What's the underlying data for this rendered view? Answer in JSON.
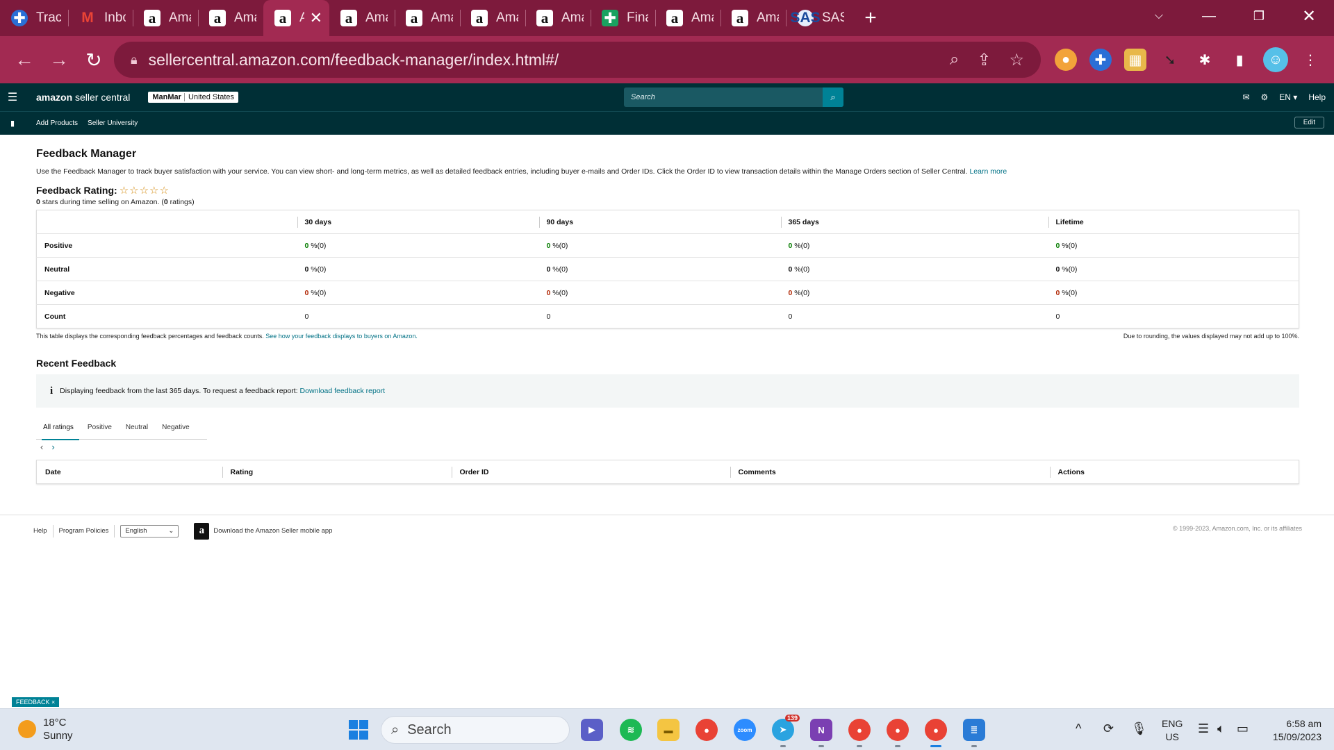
{
  "browser": {
    "tabs": [
      {
        "label": "Trackin",
        "icon": "tracking-icon",
        "active": false
      },
      {
        "label": "Inbox -",
        "icon": "gmail-icon",
        "active": false
      },
      {
        "label": "Amazo",
        "icon": "amazon-icon",
        "active": false
      },
      {
        "label": "Amazo",
        "icon": "amazon-icon",
        "active": false
      },
      {
        "label": "Am",
        "icon": "amazon-icon",
        "active": true
      },
      {
        "label": "Amazo",
        "icon": "amazon-icon",
        "active": false
      },
      {
        "label": "Amazo",
        "icon": "amazon-icon",
        "active": false
      },
      {
        "label": "Amazo",
        "icon": "amazon-icon",
        "active": false
      },
      {
        "label": "Amazo",
        "icon": "amazon-icon",
        "active": false
      },
      {
        "label": "Financ",
        "icon": "finance-icon",
        "active": false
      },
      {
        "label": "Amazo",
        "icon": "amazon-icon",
        "active": false
      },
      {
        "label": "Amazo",
        "icon": "amazon-icon",
        "active": false
      },
      {
        "label": "SAS St",
        "icon": "sas-icon",
        "active": false
      }
    ],
    "url": "sellercentral.amazon.com/feedback-manager/index.html#/"
  },
  "seller_central": {
    "logo_bold": "amazon",
    "logo_rest": " seller central",
    "store_name": "ManMar",
    "store_region": "United States",
    "search_placeholder": "Search",
    "language": "EN",
    "help": "Help",
    "nav_links": [
      "Add Products",
      "Seller University"
    ],
    "edit": "Edit"
  },
  "page": {
    "title": "Feedback Manager",
    "intro": "Use the Feedback Manager to track buyer satisfaction with your service. You can view short- and long-term metrics, as well as detailed feedback entries, including buyer e-mails and Order IDs. Click the Order ID to view transaction details within the Manage Orders section of Seller Central.",
    "learn_more": "Learn more",
    "rating_label": "Feedback Rating:",
    "stars_text": "☆☆☆☆☆",
    "stars_value": "0",
    "stars_mid": " stars during time selling on Amazon. (",
    "ratings_count": "0",
    "ratings_suffix": " ratings)"
  },
  "feedback_table": {
    "columns": [
      "30 days",
      "90 days",
      "365 days",
      "Lifetime"
    ],
    "rows": [
      {
        "label": "Positive",
        "type": "positive",
        "cells": [
          {
            "v": "0",
            "s": " %(0)"
          },
          {
            "v": "0",
            "s": " %(0)"
          },
          {
            "v": "0",
            "s": " %(0)"
          },
          {
            "v": "0",
            "s": " %(0)"
          }
        ]
      },
      {
        "label": "Neutral",
        "type": "neutral",
        "cells": [
          {
            "v": "0",
            "s": " %(0)"
          },
          {
            "v": "0",
            "s": " %(0)"
          },
          {
            "v": "0",
            "s": " %(0)"
          },
          {
            "v": "0",
            "s": " %(0)"
          }
        ]
      },
      {
        "label": "Negative",
        "type": "negative",
        "cells": [
          {
            "v": "0",
            "s": " %(0)"
          },
          {
            "v": "0",
            "s": " %(0)"
          },
          {
            "v": "0",
            "s": " %(0)"
          },
          {
            "v": "0",
            "s": " %(0)"
          }
        ]
      },
      {
        "label": "Count",
        "type": "count",
        "cells": [
          {
            "v": "",
            "s": "0"
          },
          {
            "v": "",
            "s": "0"
          },
          {
            "v": "",
            "s": "0"
          },
          {
            "v": "",
            "s": "0"
          }
        ]
      }
    ],
    "note": "This table displays the corresponding feedback percentages and feedback counts.",
    "note_link": "See how your feedback displays to buyers on Amazon.",
    "rounding_note": "Due to rounding, the values displayed may not add up to 100%."
  },
  "recent": {
    "title": "Recent Feedback",
    "info": "Displaying feedback from the last 365 days. To request a feedback report:",
    "info_link": "Download feedback report",
    "filters": [
      "All ratings",
      "Positive",
      "Neutral",
      "Negative"
    ],
    "active_filter": 0,
    "columns": [
      "Date",
      "Rating",
      "Order ID",
      "Comments",
      "Actions"
    ]
  },
  "footer": {
    "help": "Help",
    "policies": "Program Policies",
    "language": "English",
    "app_text": "Download the Amazon Seller mobile app",
    "copyright": "© 1999-2023, Amazon.com, Inc. or its affiliates",
    "feedback_tag": "FEEDBACK ×"
  },
  "taskbar": {
    "temp": "18°C",
    "condition": "Sunny",
    "search": "Search",
    "telegram_badge": "139",
    "lang_top": "ENG",
    "lang_bottom": "US",
    "time": "6:58 am",
    "date": "15/09/2023"
  },
  "colors": {
    "chrome_frame": "#7d1a3c",
    "chrome_toolbar": "#a22a52",
    "seller_header": "#002f36",
    "link": "#007185",
    "positive": "#067d00",
    "negative": "#b12704"
  }
}
